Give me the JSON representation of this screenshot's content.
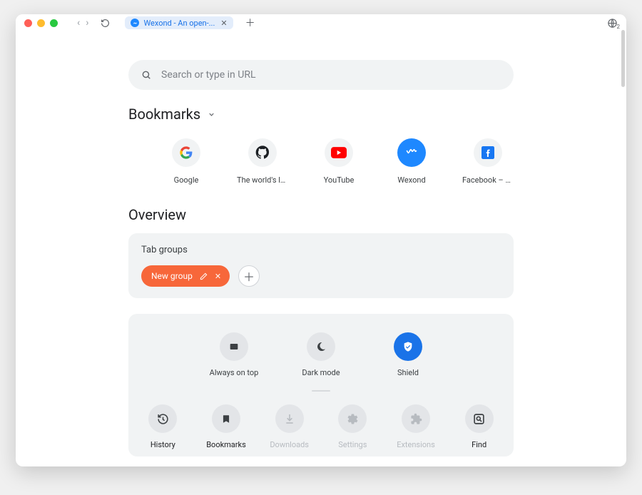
{
  "titlebar": {
    "tab_title": "Wexond - An open-...",
    "lang_badge": "2"
  },
  "search": {
    "placeholder": "Search or type in URL"
  },
  "bookmarks": {
    "heading": "Bookmarks",
    "items": [
      {
        "label": "Google",
        "icon": "google"
      },
      {
        "label": "The world's lead…",
        "icon": "github"
      },
      {
        "label": "YouTube",
        "icon": "youtube"
      },
      {
        "label": "Wexond",
        "icon": "wexond"
      },
      {
        "label": "Facebook – zal…",
        "icon": "facebook"
      }
    ]
  },
  "overview": {
    "heading": "Overview",
    "tab_groups_title": "Tab groups",
    "new_group_label": "New group"
  },
  "quick": [
    {
      "label": "Always on top",
      "icon": "square",
      "active": false
    },
    {
      "label": "Dark mode",
      "icon": "moon",
      "active": false
    },
    {
      "label": "Shield",
      "icon": "shield",
      "active": true
    }
  ],
  "actions": [
    {
      "label": "History",
      "icon": "history",
      "state": "strong"
    },
    {
      "label": "Bookmarks",
      "icon": "bookmark",
      "state": "strong"
    },
    {
      "label": "Downloads",
      "icon": "download",
      "state": "muted"
    },
    {
      "label": "Settings",
      "icon": "gear",
      "state": "muted"
    },
    {
      "label": "Extensions",
      "icon": "puzzle",
      "state": "muted"
    },
    {
      "label": "Find",
      "icon": "find",
      "state": "strong"
    }
  ],
  "colors": {
    "accent": "#1a73e8",
    "group_pill": "#f7673a"
  }
}
